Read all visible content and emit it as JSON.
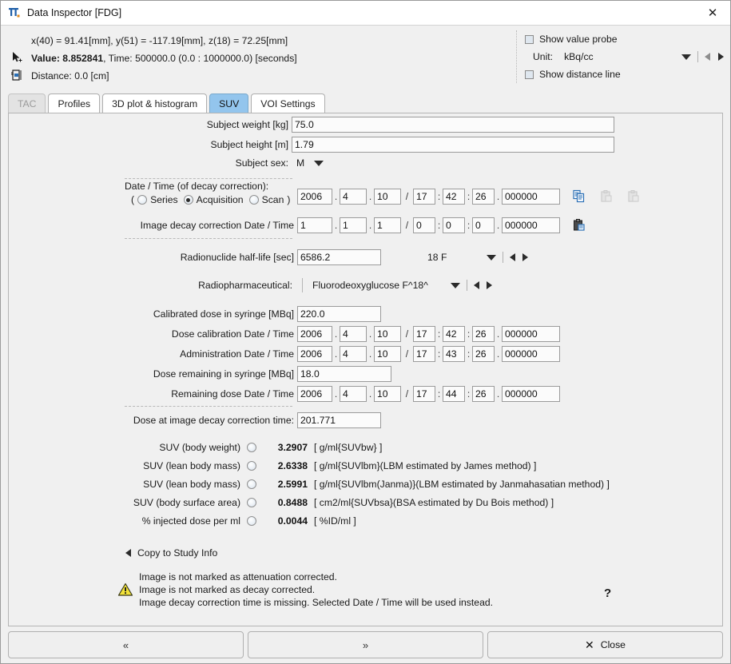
{
  "window": {
    "title": "Data Inspector [FDG]",
    "close_icon": "close-icon",
    "app_icon": "data-inspector-icon"
  },
  "info": {
    "coords": "x(40) = 91.41[mm],  y(51) = -117.19[mm],  z(18) = 72.25[mm]",
    "value_label": "Value: 8.852841",
    "value_rest": ", Time: 500000.0 (0.0 : 1000000.0) [seconds]",
    "distance": "Distance: 0.0 [cm]",
    "show_value_probe": "Show value probe",
    "unit_label": "Unit:",
    "unit_value": "kBq/cc",
    "show_distance_line": "Show distance line"
  },
  "tabs": [
    {
      "label": "TAC",
      "state": "disabled"
    },
    {
      "label": "Profiles",
      "state": "normal"
    },
    {
      "label": "3D plot & histogram",
      "state": "normal"
    },
    {
      "label": "SUV",
      "state": "active"
    },
    {
      "label": "VOI Settings",
      "state": "normal"
    }
  ],
  "form": {
    "subject_weight_label": "Subject weight [kg]",
    "subject_weight_value": "75.0",
    "subject_height_label": "Subject height [m]",
    "subject_height_value": "1.79",
    "subject_sex_label": "Subject sex:",
    "subject_sex_value": "M",
    "datetime_label": "Date / Time (of decay correction):",
    "paren_open": "(",
    "series_label": "Series",
    "acquisition_label": "Acquisition",
    "scan_label": "Scan",
    "paren_close": ")",
    "decay_dt": {
      "year": "2006",
      "month": "4",
      "day": "10",
      "hour": "17",
      "min": "42",
      "sec": "26",
      "frac": "000000"
    },
    "image_decay_label": "Image decay correction Date / Time",
    "image_decay_dt": {
      "year": "1",
      "month": "1",
      "day": "1",
      "hour": "0",
      "min": "0",
      "sec": "0",
      "frac": "000000"
    },
    "halflife_label": "Radionuclide half-life [sec]",
    "halflife_value": "6586.2",
    "nuclide_value": "18 F",
    "radiopharm_label": "Radiopharmaceutical:",
    "radiopharm_value": "Fluorodeoxyglucose F^18^",
    "calibrated_dose_label": "Calibrated dose in syringe [MBq]",
    "calibrated_dose_value": "220.0",
    "dose_cal_label": "Dose calibration Date / Time",
    "dose_cal_dt": {
      "year": "2006",
      "month": "4",
      "day": "10",
      "hour": "17",
      "min": "42",
      "sec": "26",
      "frac": "000000"
    },
    "admin_label": "Administration Date / Time",
    "admin_dt": {
      "year": "2006",
      "month": "4",
      "day": "10",
      "hour": "17",
      "min": "43",
      "sec": "26",
      "frac": "000000"
    },
    "remaining_dose_label": "Dose remaining in syringe [MBq]",
    "remaining_dose_value": "18.0",
    "remaining_dt_label": "Remaining dose Date / Time",
    "remaining_dt": {
      "year": "2006",
      "month": "4",
      "day": "10",
      "hour": "17",
      "min": "44",
      "sec": "26",
      "frac": "000000"
    },
    "dose_at_decay_label": "Dose at image decay correction time:",
    "dose_at_decay_value": "201.771",
    "sep_dot": ".",
    "sep_colon": ":",
    "sep_slash": "/"
  },
  "suv": [
    {
      "label": "SUV (body weight)",
      "value": "3.2907",
      "unit": "[ g/ml{SUVbw} ]"
    },
    {
      "label": "SUV (lean body mass)",
      "value": "2.6338",
      "unit": "[ g/ml{SUVlbm}(LBM estimated by James method) ]"
    },
    {
      "label": "SUV (lean body mass)",
      "value": "2.5991",
      "unit": "[ g/ml{SUVlbm(Janma)}(LBM estimated by Janmahasatian method) ]"
    },
    {
      "label": "SUV (body surface area)",
      "value": "0.8488",
      "unit": "[ cm2/ml{SUVbsa}(BSA estimated by Du Bois method) ]"
    },
    {
      "label": "% injected dose per ml",
      "value": "0.0044",
      "unit": "[ %ID/ml ]"
    }
  ],
  "copy_to_study_info": "Copy to Study Info",
  "warnings": [
    "Image is not marked as attenuation corrected.",
    "Image is not marked as decay corrected.",
    "Image decay correction time is missing. Selected Date / Time will be used instead."
  ],
  "help_glyph": "?",
  "buttons": {
    "prev": "«",
    "next": "»",
    "close": "Close"
  },
  "colors": {
    "accent": "#93c5ed",
    "field_bg": "#fbfbfb",
    "panel_bg": "#f0f0f0",
    "warning": "#f2e23a"
  }
}
